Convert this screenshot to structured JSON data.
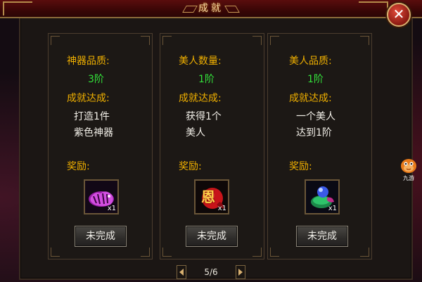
{
  "title": "成就",
  "close_label": "✕",
  "panels": [
    {
      "category_label": "神器品质:",
      "category_value": "3阶",
      "requirement_label": "成就达成:",
      "requirement_line1": "打造1件",
      "requirement_line2": "紫色神器",
      "reward_label": "奖励:",
      "reward_icon": "purple-tiger-icon",
      "reward_qty": "x1",
      "status_button": "未完成"
    },
    {
      "category_label": "美人数量:",
      "category_value": "1阶",
      "requirement_label": "成就达成:",
      "requirement_line1": "获得1个",
      "requirement_line2": "美人",
      "reward_label": "奖励:",
      "reward_icon": "red-favor-orb-icon",
      "reward_glyph": "恩",
      "reward_qty": "x1",
      "status_button": "未完成"
    },
    {
      "category_label": "美人品质:",
      "category_value": "1阶",
      "requirement_label": "成就达成:",
      "requirement_line1": "一个美人",
      "requirement_line2": "达到1阶",
      "reward_label": "奖励:",
      "reward_icon": "potion-bag-icon",
      "reward_qty": "x1",
      "status_button": "未完成"
    }
  ],
  "pager": {
    "text": "5/6"
  },
  "mascot": {
    "label": "九游",
    "icon": "orange-mascot-icon"
  },
  "colors": {
    "label_gold": "#f0b000",
    "value_green": "#33e03a",
    "text_white": "#f2efe8",
    "title_red": "#5a0d0d"
  }
}
